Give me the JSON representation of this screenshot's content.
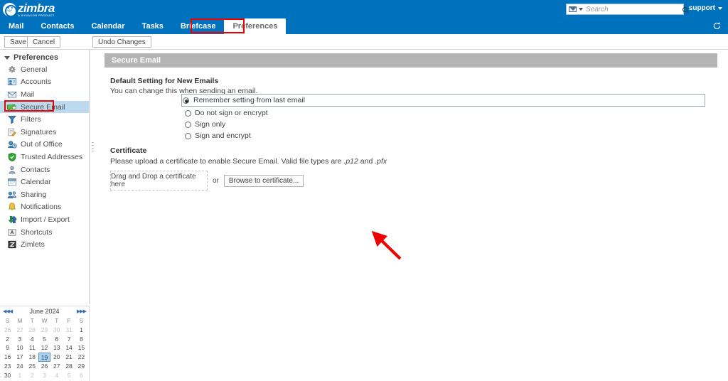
{
  "app": {
    "logo_text": "zimbra",
    "logo_tagline": "A SYNACOR PRODUCT"
  },
  "header": {
    "search_placeholder": "Search",
    "search_value": "",
    "search_type_icon": "envelope-icon",
    "search_go_icon": "search-icon",
    "support_label": "support",
    "refresh_icon": "refresh-icon"
  },
  "tabs": [
    {
      "label": "Mail",
      "active": false
    },
    {
      "label": "Contacts",
      "active": false
    },
    {
      "label": "Calendar",
      "active": false
    },
    {
      "label": "Tasks",
      "active": false
    },
    {
      "label": "Briefcase",
      "active": false
    },
    {
      "label": "Preferences",
      "active": true
    }
  ],
  "toolbar": {
    "save_label": "Save",
    "cancel_label": "Cancel",
    "undo_label": "Undo Changes"
  },
  "sidebar": {
    "root_label": "Preferences",
    "items": [
      {
        "label": "General",
        "icon": "gear-icon",
        "selected": false
      },
      {
        "label": "Accounts",
        "icon": "accounts-icon",
        "selected": false
      },
      {
        "label": "Mail",
        "icon": "envelope-icon",
        "selected": false
      },
      {
        "label": "Secure Email",
        "icon": "secure-email-icon",
        "selected": true
      },
      {
        "label": "Filters",
        "icon": "filter-icon",
        "selected": false
      },
      {
        "label": "Signatures",
        "icon": "signature-icon",
        "selected": false
      },
      {
        "label": "Out of Office",
        "icon": "out-of-office-icon",
        "selected": false
      },
      {
        "label": "Trusted Addresses",
        "icon": "shield-check-icon",
        "selected": false
      },
      {
        "label": "Contacts",
        "icon": "contacts-icon",
        "selected": false
      },
      {
        "label": "Calendar",
        "icon": "calendar-icon",
        "selected": false
      },
      {
        "label": "Sharing",
        "icon": "sharing-icon",
        "selected": false
      },
      {
        "label": "Notifications",
        "icon": "bell-icon",
        "selected": false
      },
      {
        "label": "Import / Export",
        "icon": "import-export-icon",
        "selected": false
      },
      {
        "label": "Shortcuts",
        "icon": "keyboard-key-icon",
        "selected": false
      },
      {
        "label": "Zimlets",
        "icon": "zimlet-icon",
        "selected": false
      }
    ]
  },
  "main": {
    "panel_title": "Secure Email",
    "default_setting": {
      "heading": "Default Setting for New Emails",
      "description": "You can change this when sending an email.",
      "options": [
        {
          "label": "Remember setting from last email",
          "selected": true
        },
        {
          "label": "Do not sign or encrypt",
          "selected": false
        },
        {
          "label": "Sign only",
          "selected": false
        },
        {
          "label": "Sign and encrypt",
          "selected": false
        }
      ]
    },
    "certificate": {
      "heading": "Certificate",
      "description_before": "Please upload a certificate to enable Secure Email. Valid file types are ",
      "filetype_1": ".p12",
      "description_mid": " and ",
      "filetype_2": ".pfx",
      "dropzone_label": "Drag and Drop a certificate here",
      "or_label": "or",
      "browse_label": "Browse to certificate..."
    }
  },
  "mini_calendar": {
    "title": "June 2024",
    "prev_year_icon": "double-left-icon",
    "prev_month_icon": "left-icon",
    "next_month_icon": "right-icon",
    "next_year_icon": "double-right-icon",
    "day_names": [
      "S",
      "M",
      "T",
      "W",
      "T",
      "F",
      "S"
    ],
    "weeks": [
      [
        {
          "d": "26",
          "o": true
        },
        {
          "d": "27",
          "o": true
        },
        {
          "d": "28",
          "o": true
        },
        {
          "d": "29",
          "o": true
        },
        {
          "d": "30",
          "o": true
        },
        {
          "d": "31",
          "o": true
        },
        {
          "d": "1",
          "o": false
        }
      ],
      [
        {
          "d": "2",
          "o": false
        },
        {
          "d": "3",
          "o": false
        },
        {
          "d": "4",
          "o": false
        },
        {
          "d": "5",
          "o": false
        },
        {
          "d": "6",
          "o": false
        },
        {
          "d": "7",
          "o": false
        },
        {
          "d": "8",
          "o": false
        }
      ],
      [
        {
          "d": "9",
          "o": false
        },
        {
          "d": "10",
          "o": false
        },
        {
          "d": "11",
          "o": false
        },
        {
          "d": "12",
          "o": false
        },
        {
          "d": "13",
          "o": false
        },
        {
          "d": "14",
          "o": false
        },
        {
          "d": "15",
          "o": false
        }
      ],
      [
        {
          "d": "16",
          "o": false
        },
        {
          "d": "17",
          "o": false
        },
        {
          "d": "18",
          "o": false
        },
        {
          "d": "19",
          "o": false,
          "today": true
        },
        {
          "d": "20",
          "o": false
        },
        {
          "d": "21",
          "o": false
        },
        {
          "d": "22",
          "o": false
        }
      ],
      [
        {
          "d": "23",
          "o": false
        },
        {
          "d": "24",
          "o": false
        },
        {
          "d": "25",
          "o": false
        },
        {
          "d": "26",
          "o": false
        },
        {
          "d": "27",
          "o": false
        },
        {
          "d": "28",
          "o": false
        },
        {
          "d": "29",
          "o": false
        }
      ],
      [
        {
          "d": "30",
          "o": false
        },
        {
          "d": "1",
          "o": true
        },
        {
          "d": "2",
          "o": true
        },
        {
          "d": "3",
          "o": true
        },
        {
          "d": "4",
          "o": true
        },
        {
          "d": "5",
          "o": true
        },
        {
          "d": "6",
          "o": true
        }
      ]
    ]
  },
  "annotations": {
    "color": "#ee0000",
    "box_preferences_tab": true,
    "box_secure_email_item": true,
    "arrow_to_browse_button": true
  },
  "colors": {
    "brand_blue": "#0071bc",
    "panel_title_gray": "#b4b4b4",
    "selection_blue": "#bcd9ee",
    "annotation_red": "#ee0000"
  }
}
